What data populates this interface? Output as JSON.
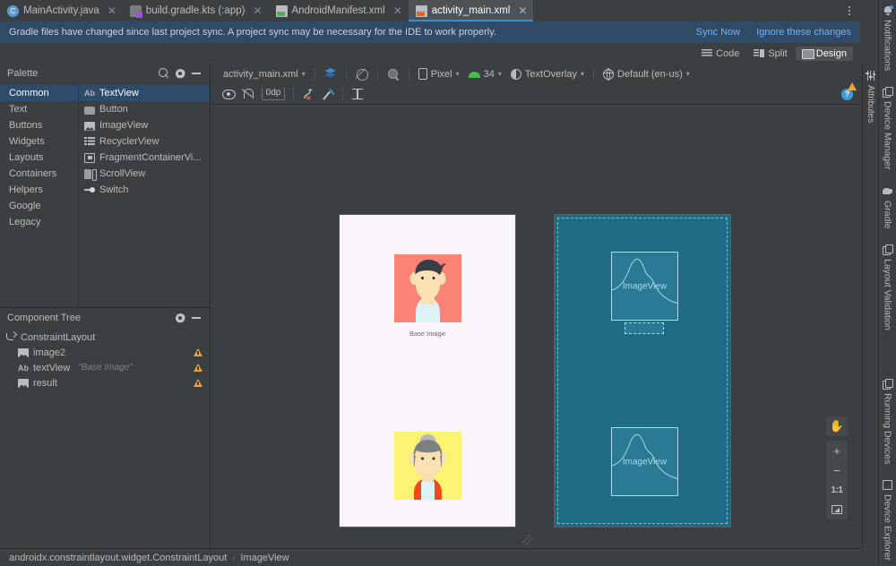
{
  "window": {
    "tabs": [
      {
        "label": "MainActivity.java",
        "icon": "java-class-icon",
        "active": false
      },
      {
        "label": "build.gradle.kts (:app)",
        "icon": "gradle-file-icon",
        "active": false
      },
      {
        "label": "AndroidManifest.xml",
        "icon": "android-manifest-icon",
        "active": false
      },
      {
        "label": "activity_main.xml",
        "icon": "layout-xml-icon",
        "active": true
      }
    ],
    "more_label": "⋮"
  },
  "banner": {
    "message": "Gradle files have changed since last project sync. A project sync may be necessary for the IDE to work properly.",
    "sync_now": "Sync Now",
    "ignore": "Ignore these changes",
    "link_color": "#76b3ef",
    "background": "#2f4a66"
  },
  "editor_modes": [
    {
      "label": "Code",
      "icon": "code-lines-icon",
      "active": false
    },
    {
      "label": "Split",
      "icon": "split-view-icon",
      "active": false
    },
    {
      "label": "Design",
      "icon": "design-image-icon",
      "active": true
    }
  ],
  "palette": {
    "title": "Palette",
    "search_icon": "search-icon",
    "gear_icon": "gear-icon",
    "minimize_icon": "minimize-icon",
    "categories": [
      {
        "label": "Common",
        "active": true
      },
      {
        "label": "Text",
        "active": false
      },
      {
        "label": "Buttons",
        "active": false
      },
      {
        "label": "Widgets",
        "active": false
      },
      {
        "label": "Layouts",
        "active": false
      },
      {
        "label": "Containers",
        "active": false
      },
      {
        "label": "Helpers",
        "active": false
      },
      {
        "label": "Google",
        "active": false
      },
      {
        "label": "Legacy",
        "active": false
      }
    ],
    "items": [
      {
        "label": "TextView",
        "icon": "textview-icon",
        "active": true
      },
      {
        "label": "Button",
        "icon": "button-icon",
        "active": false
      },
      {
        "label": "ImageView",
        "icon": "imageview-icon",
        "active": false
      },
      {
        "label": "RecyclerView",
        "icon": "recyclerview-icon",
        "active": false
      },
      {
        "label": "FragmentContainerVi...",
        "icon": "fragment-container-icon",
        "active": false
      },
      {
        "label": "ScrollView",
        "icon": "scrollview-icon",
        "active": false
      },
      {
        "label": "Switch",
        "icon": "switch-icon",
        "active": false
      }
    ]
  },
  "component_tree": {
    "title": "Component Tree",
    "gear_icon": "gear-icon",
    "minimize_icon": "minimize-icon",
    "nodes": [
      {
        "label": "ConstraintLayout",
        "sub": "",
        "icon": "constraintlayout-icon",
        "indent": 0,
        "warning": false
      },
      {
        "label": "image2",
        "sub": "",
        "icon": "imageview-icon",
        "indent": 1,
        "warning": true
      },
      {
        "label": "textView",
        "sub": "\"Base Image\"",
        "icon": "textview-icon",
        "indent": 1,
        "warning": true
      },
      {
        "label": "result",
        "sub": "",
        "icon": "imageview-icon",
        "indent": 1,
        "warning": true
      }
    ],
    "warning_color": "#e8a33d"
  },
  "surface_toolbar": {
    "file_label": "activity_main.xml",
    "view_mode_icon": "design-blueprint-layers-icon",
    "no_blueprint_icon": "disable-blueprint-icon",
    "zoom_pan_icon": "pan-zoom-icon",
    "device_label": "Pixel",
    "device_icon": "phone-icon",
    "api_label": "34",
    "api_icon": "android-icon",
    "theme_label": "TextOverlay",
    "theme_icon": "theme-icon",
    "locale_label": "Default (en-us)",
    "locale_icon": "globe-icon",
    "warning_icon": "warning-icon"
  },
  "surface_toolbar2": {
    "icons": [
      {
        "name": "show-constraints-eye-icon"
      },
      {
        "name": "autoconnect-magnet-icon"
      },
      {
        "name": "default-margin-chip"
      },
      {
        "name": "clear-constraints-icon"
      },
      {
        "name": "infer-constraints-magic-icon"
      },
      {
        "name": "align-baseline-icon"
      }
    ],
    "margin_value": "0dp",
    "help_label": "?"
  },
  "canvas": {
    "design_preview": {
      "caption": "Base Image",
      "avatar_top": {
        "background": "#fb8375",
        "skin": "#fbe0b4",
        "hair": "#393d45",
        "shirt": "#dcf2f4"
      },
      "avatar_bottom": {
        "background": "#fdf373",
        "skin": "#fbe0b4",
        "hair": "#9a9a9a",
        "shirt": "#f04a1a"
      }
    },
    "blueprint_preview": {
      "background": "#1f6b86",
      "outline": "#a7dcec",
      "views": [
        {
          "label": "ImageView"
        },
        {
          "label": "ImageView"
        }
      ]
    },
    "zoom_controls": [
      {
        "name": "pan-hand-button",
        "label": "✋"
      },
      {
        "name": "zoom-in-button",
        "label": "+"
      },
      {
        "name": "zoom-out-button",
        "label": "−"
      },
      {
        "name": "zoom-actual-size-button",
        "label": "1:1"
      },
      {
        "name": "zoom-to-fit-button",
        "label": ""
      }
    ]
  },
  "right_tools": [
    {
      "label": "Notifications",
      "icon": "bell-icon",
      "badge": true
    },
    {
      "label": "Device Manager",
      "icon": "device-manager-icon",
      "badge": false
    },
    {
      "label": "Gradle",
      "icon": "gradle-elephant-icon",
      "badge": false
    },
    {
      "label": "Layout Validation",
      "icon": "layout-validation-icon",
      "badge": false
    },
    {
      "label": "Running Devices",
      "icon": "running-devices-icon",
      "badge": false
    },
    {
      "label": "Device Explorer",
      "icon": "device-explorer-icon",
      "badge": false
    }
  ],
  "attributes_bar": {
    "label": "Attributes",
    "icon": "sliders-icon"
  },
  "status_bar": {
    "breadcrumb": [
      "androidx.constraintlayout.widget.ConstraintLayout",
      "ImageView"
    ],
    "separator": "›"
  }
}
